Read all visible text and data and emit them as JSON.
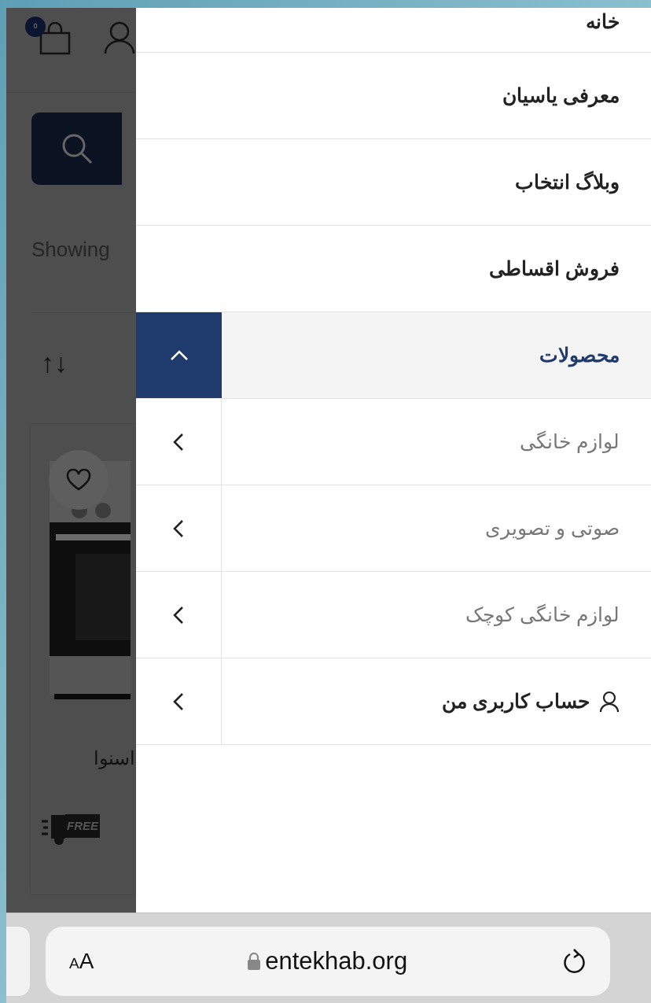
{
  "page": {
    "cart_badge": "0",
    "results_text": "Showing",
    "sort_icon_text": "↑↓",
    "product_title": "اسنوا",
    "shipping_badge": "FREE"
  },
  "menu": {
    "items": [
      {
        "label": "خانه",
        "kind": "link"
      },
      {
        "label": "معرفی یاسیان",
        "kind": "link"
      },
      {
        "label": "وبلاگ انتخاب",
        "kind": "link"
      },
      {
        "label": "فروش اقساطی",
        "kind": "link"
      },
      {
        "label": "محصولات",
        "kind": "submenu",
        "expanded": true,
        "children": [
          {
            "label": "لوازم خانگی",
            "kind": "submenu",
            "expanded": false
          },
          {
            "label": "صوتی و تصویری",
            "kind": "submenu",
            "expanded": false
          },
          {
            "label": "لوازم خانگی کوچک",
            "kind": "submenu",
            "expanded": false
          }
        ]
      },
      {
        "label": "حساب کاربری من",
        "kind": "account",
        "expanded": false
      }
    ]
  },
  "browser_bar": {
    "text_size_button": "AA",
    "url": "entekhab.org"
  }
}
